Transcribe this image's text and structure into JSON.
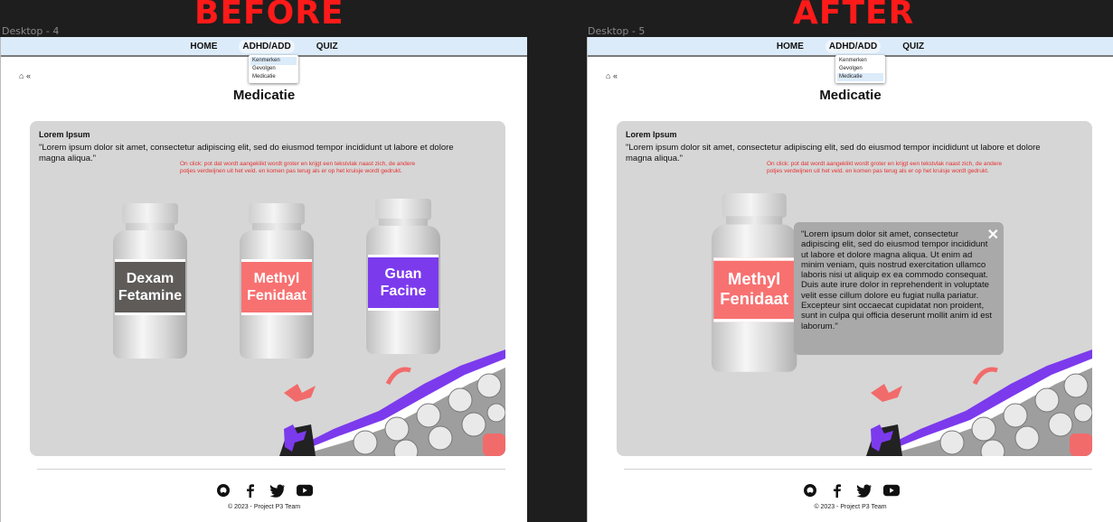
{
  "before": {
    "heading": "BEFORE",
    "frame_label": "Desktop - 4"
  },
  "after": {
    "heading": "AFTER",
    "frame_label": "Desktop - 5"
  },
  "nav": {
    "home": "HOME",
    "adhd": "ADHD/ADD",
    "quiz": "QUIZ"
  },
  "dropdown": {
    "items": [
      "Kenmerken",
      "Gevolgen",
      "Medicatie"
    ],
    "before_selected": "Kenmerken",
    "after_selected": "Medicatie"
  },
  "breadcrumb": {
    "home_icon": "home-icon",
    "chevron": "«"
  },
  "page": {
    "title": "Medicatie"
  },
  "panel": {
    "title": "Lorem Ipsum",
    "text": "\"Lorem ipsum dolor sit amet, consectetur adipiscing elit, sed do eiusmod tempor incididunt ut labore et dolore magna aliqua.\"",
    "note": "On click: pot dat wordt aangeklikt wordt groter en krijgt een tekstvlak naast zich, de andere potjes verdwijnen uit het veld. en komen pas terug als er op het kruisje wordt gedrukt."
  },
  "pills": [
    {
      "line1": "Dexam",
      "line2": "Fetamine",
      "color": "#5e5b58"
    },
    {
      "line1": "Methyl",
      "line2": "Fenidaat",
      "color": "#f87171"
    },
    {
      "line1": "Guan",
      "line2": "Facine",
      "color": "#7c3aed"
    }
  ],
  "popup": {
    "text": "\"Lorem ipsum dolor sit amet, consectetur adipiscing elit, sed do eiusmod tempor incididunt ut labore et dolore magna aliqua. Ut enim ad minim veniam, quis nostrud exercitation ullamco laboris nisi ut aliquip ex ea commodo consequat. Duis aute irure dolor in reprehenderit in voluptate velit esse cillum dolore eu fugiat nulla pariatur. Excepteur sint occaecat cupidatat non proident, sunt in culpa qui officia deserunt mollit anim id est laborum.\"",
    "close": "✕"
  },
  "footer": {
    "icons": [
      "github-icon",
      "facebook-icon",
      "twitter-icon",
      "youtube-icon"
    ],
    "copyright": "© 2023 - Project P3 Team"
  },
  "colors": {
    "accent_red": "#ff1a1a",
    "nav_bg": "#dcebf9",
    "panel_bg": "#d6d6d6"
  }
}
